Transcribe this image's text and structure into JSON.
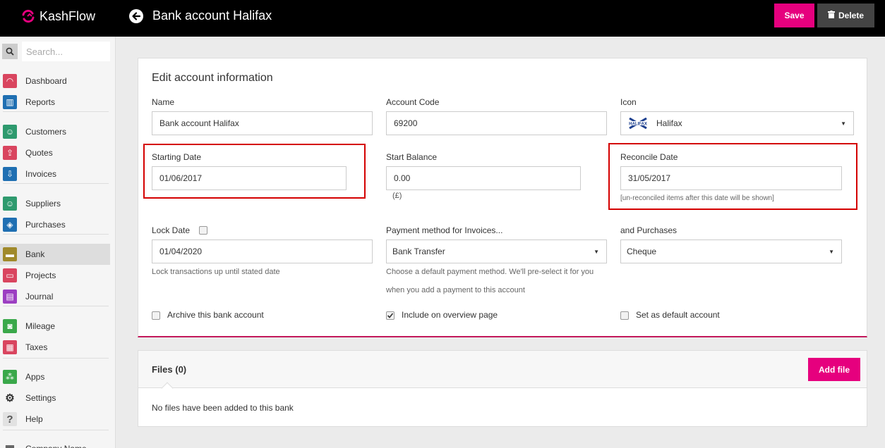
{
  "app": {
    "name": "KashFlow"
  },
  "header": {
    "title": "Bank account Halifax",
    "save_label": "Save",
    "delete_label": "Delete"
  },
  "sidebar": {
    "search_placeholder": "Search...",
    "items": [
      {
        "label": "Dashboard",
        "icon": "dashboard-gauge-icon",
        "color": "#d9455f"
      },
      {
        "label": "Reports",
        "icon": "reports-chart-icon",
        "color": "#1f6fb2"
      },
      {
        "label": "Customers",
        "icon": "customers-people-icon",
        "color": "#2e9a6e"
      },
      {
        "label": "Quotes",
        "icon": "quotes-upload-icon",
        "color": "#d9455f"
      },
      {
        "label": "Invoices",
        "icon": "invoices-download-icon",
        "color": "#1f6fb2"
      },
      {
        "label": "Suppliers",
        "icon": "suppliers-people-icon",
        "color": "#2e9a6e"
      },
      {
        "label": "Purchases",
        "icon": "purchases-tag-icon",
        "color": "#1f6fb2"
      },
      {
        "label": "Bank",
        "icon": "bank-wallet-icon",
        "color": "#a08a2b"
      },
      {
        "label": "Projects",
        "icon": "projects-folder-icon",
        "color": "#d9455f"
      },
      {
        "label": "Journal",
        "icon": "journal-book-icon",
        "color": "#9c3fc2"
      },
      {
        "label": "Mileage",
        "icon": "mileage-car-icon",
        "color": "#3aa84a"
      },
      {
        "label": "Taxes",
        "icon": "taxes-calculator-icon",
        "color": "#d9455f"
      },
      {
        "label": "Apps",
        "icon": "apps-nodes-icon",
        "color": "#3aa84a"
      },
      {
        "label": "Settings",
        "icon": "settings-gear-icon",
        "color": "#333333"
      },
      {
        "label": "Help",
        "icon": "help-question-icon",
        "color": "#555555"
      },
      {
        "label": "Company Name",
        "icon": "company-building-icon",
        "color": "#555555"
      }
    ]
  },
  "form": {
    "title": "Edit account information",
    "name": {
      "label": "Name",
      "value": "Bank account Halifax"
    },
    "account_code": {
      "label": "Account Code",
      "value": "69200"
    },
    "icon": {
      "label": "Icon",
      "value": "Halifax",
      "logo_text": "HALIFAX"
    },
    "starting_date": {
      "label": "Starting Date",
      "value": "01/06/2017"
    },
    "start_balance": {
      "label": "Start Balance",
      "value": "0.00",
      "currency_note": "(£)"
    },
    "reconcile_date": {
      "label": "Reconcile Date",
      "value": "31/05/2017",
      "help": "[un-reconciled items after this date will be shown]"
    },
    "lock_date": {
      "label": "Lock Date",
      "value": "01/04/2020",
      "help": "Lock transactions up until stated date",
      "checked": false
    },
    "payment_method": {
      "label": "Payment method for Invoices...",
      "value": "Bank Transfer",
      "help_line1": "Choose a default payment method. We'll pre-select it for you",
      "help_line2": "when you add a payment to this account"
    },
    "purchases_method": {
      "label": "and Purchases",
      "value": "Cheque"
    },
    "archive": {
      "label": "Archive this bank account",
      "checked": false
    },
    "overview": {
      "label": "Include on overview page",
      "checked": true
    },
    "default_account": {
      "label": "Set as default account",
      "checked": false
    }
  },
  "files": {
    "title": "Files (0)",
    "add_label": "Add file",
    "empty_text": "No files have been added to this bank"
  },
  "colors": {
    "accent": "#e6007e",
    "highlight": "#d40000",
    "topbar": "#000000"
  }
}
